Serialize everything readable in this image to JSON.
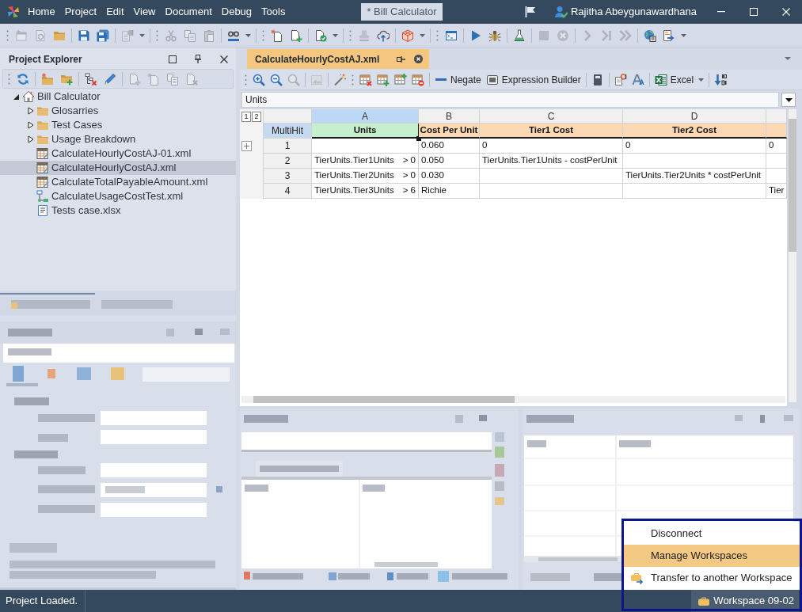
{
  "window": {
    "menu": [
      "Home",
      "Project",
      "Edit",
      "View",
      "Document",
      "Debug",
      "Tools"
    ],
    "document_title": "* Bill Calculator",
    "user": "Rajitha Abeygunawardhana"
  },
  "toolbar": [
    {
      "kind": "grip"
    },
    {
      "kind": "new-window",
      "disabled": true
    },
    {
      "kind": "reload",
      "disabled": true
    },
    {
      "kind": "open",
      "disabled": false
    },
    {
      "kind": "separator"
    },
    {
      "kind": "save",
      "disabled": false
    },
    {
      "kind": "save-all",
      "disabled": false
    },
    {
      "kind": "separator"
    },
    {
      "kind": "publish",
      "disabled": true,
      "dropdown": true
    },
    {
      "kind": "separator"
    },
    {
      "kind": "grip"
    },
    {
      "kind": "cut",
      "disabled": true
    },
    {
      "kind": "copy",
      "disabled": true
    },
    {
      "kind": "paste",
      "disabled": true
    },
    {
      "kind": "separator"
    },
    {
      "kind": "spellcheck",
      "disabled": false,
      "dropdown": true
    },
    {
      "kind": "separator"
    },
    {
      "kind": "grip"
    },
    {
      "kind": "new-file",
      "disabled": false
    },
    {
      "kind": "add-file",
      "disabled": false
    },
    {
      "kind": "separator"
    },
    {
      "kind": "validate",
      "disabled": false,
      "dropdown": true
    },
    {
      "kind": "separator"
    },
    {
      "kind": "grip"
    },
    {
      "kind": "stamp",
      "disabled": true
    },
    {
      "kind": "upload",
      "disabled": false
    },
    {
      "kind": "separator"
    },
    {
      "kind": "cube",
      "disabled": false,
      "dropdown": true
    },
    {
      "kind": "separator"
    },
    {
      "kind": "grip"
    },
    {
      "kind": "console",
      "disabled": false
    },
    {
      "kind": "separator"
    },
    {
      "kind": "run",
      "disabled": false
    },
    {
      "kind": "bug",
      "disabled": false
    },
    {
      "kind": "separator"
    },
    {
      "kind": "flask",
      "disabled": false
    },
    {
      "kind": "separator"
    },
    {
      "kind": "stop",
      "disabled": true
    },
    {
      "kind": "cancel",
      "disabled": true
    },
    {
      "kind": "separator"
    },
    {
      "kind": "step",
      "disabled": true
    },
    {
      "kind": "step-end",
      "disabled": true
    },
    {
      "kind": "fast-forward",
      "disabled": true
    },
    {
      "kind": "separator"
    },
    {
      "kind": "globe",
      "disabled": false
    },
    {
      "kind": "export",
      "disabled": false,
      "dropdown": true
    }
  ],
  "project_explorer": {
    "title": "Project Explorer",
    "toolbar": [
      {
        "kind": "grip"
      },
      {
        "kind": "refresh",
        "disabled": false
      },
      {
        "kind": "separator"
      },
      {
        "kind": "new-folder",
        "disabled": false
      },
      {
        "kind": "add-folder",
        "disabled": false
      },
      {
        "kind": "separator"
      },
      {
        "kind": "delete-tree",
        "disabled": false
      },
      {
        "kind": "pencil",
        "disabled": false
      },
      {
        "kind": "separator"
      },
      {
        "kind": "add-file",
        "disabled": true
      },
      {
        "kind": "new-file",
        "disabled": true
      },
      {
        "kind": "copy",
        "disabled": true
      },
      {
        "kind": "delete-file",
        "disabled": true
      }
    ],
    "tree": [
      {
        "label": "Bill Calculator",
        "kind": "project",
        "expanded": true,
        "selected": false,
        "children": [
          {
            "label": "Glosarries",
            "kind": "folder",
            "expanded": false,
            "selected": false
          },
          {
            "label": "Test Cases",
            "kind": "folder",
            "expanded": false,
            "selected": false
          },
          {
            "label": "Usage Breakdown",
            "kind": "folder",
            "expanded": false,
            "selected": false
          },
          {
            "label": "CalculateHourlyCostAJ-01.xml",
            "kind": "table",
            "selected": false
          },
          {
            "label": "CalculateHourlyCostAJ.xml",
            "kind": "table",
            "selected": true
          },
          {
            "label": "CalculateTotalPayableAmount.xml",
            "kind": "table",
            "selected": false
          },
          {
            "label": "CalculateUsageCostTest.xml",
            "kind": "flow",
            "selected": false
          },
          {
            "label": "Tests case.xlsx",
            "kind": "sheet",
            "selected": false
          }
        ]
      }
    ]
  },
  "editor": {
    "tabs": [
      {
        "label": "CalculateHourlyCostAJ.xml",
        "selected": true
      }
    ],
    "toolbar": [
      {
        "kind": "grip"
      },
      {
        "kind": "zoom-in",
        "disabled": false
      },
      {
        "kind": "zoom-out",
        "disabled": false
      },
      {
        "kind": "zoom",
        "disabled": true
      },
      {
        "kind": "separator"
      },
      {
        "kind": "image",
        "disabled": true
      },
      {
        "kind": "separator"
      },
      {
        "kind": "wand",
        "disabled": false
      },
      {
        "kind": "grip"
      },
      {
        "kind": "table-delete",
        "disabled": false
      },
      {
        "kind": "table-add",
        "disabled": false
      },
      {
        "kind": "table-add-col",
        "disabled": false
      },
      {
        "kind": "table-remove",
        "disabled": false
      },
      {
        "kind": "separator"
      },
      {
        "kind": "negate",
        "label": "Negate"
      },
      {
        "kind": "expression",
        "label": "Expression Builder"
      },
      {
        "kind": "separator"
      },
      {
        "kind": "book",
        "disabled": false
      },
      {
        "kind": "separator"
      },
      {
        "kind": "rules",
        "disabled": false
      },
      {
        "kind": "font",
        "disabled": false
      },
      {
        "kind": "separator"
      },
      {
        "kind": "excel",
        "label": "Excel",
        "dropdown": true
      },
      {
        "kind": "separator"
      },
      {
        "kind": "sort",
        "disabled": false
      }
    ],
    "formula": "Units",
    "grid": {
      "outline_levels": [
        "1",
        "2"
      ],
      "row_header_caption": "MultiHit",
      "columns": [
        {
          "letter": "A",
          "heading": "Units",
          "kind": "condition",
          "selected": true
        },
        {
          "letter": "B",
          "heading": "Cost Per Unit",
          "kind": "action",
          "selected": false
        },
        {
          "letter": "C",
          "heading": "Tier1 Cost",
          "kind": "action",
          "selected": false
        },
        {
          "letter": "D",
          "heading": "Tier2 Cost",
          "kind": "action",
          "selected": false
        },
        {
          "kind": "action",
          "selected": false
        }
      ],
      "rows": [
        {
          "number": "1",
          "expandable": true,
          "cells": [
            null,
            "0.060",
            "0",
            "0",
            "0"
          ]
        },
        {
          "number": "2",
          "expandable": false,
          "cells": [
            {
              "text": "TierUnits.Tier1Units",
              "condition": "> 0"
            },
            "0.050",
            "TierUnits.Tier1Units - costPerUnit",
            null,
            null
          ]
        },
        {
          "number": "3",
          "expandable": false,
          "cells": [
            {
              "text": "TierUnits.Tier2Units",
              "condition": "> 0"
            },
            "0.030",
            null,
            "TierUnits.Tier2Units * costPerUnit",
            null
          ]
        },
        {
          "number": "4",
          "expandable": false,
          "cells": [
            {
              "text": "TierUnits.Tier3Units",
              "condition": "> 6"
            },
            "Richie",
            null,
            null,
            "Tier"
          ]
        }
      ]
    }
  },
  "status_bar": {
    "message": "Project Loaded.",
    "workspace": "Workspace 09-02"
  },
  "workspace_menu": {
    "items": [
      {
        "label": "Disconnect",
        "kind": "plain",
        "selected": false
      },
      {
        "label": "Manage Workspaces",
        "kind": "plain",
        "selected": true
      },
      {
        "label": "Transfer to another Workspace",
        "kind": "transfer",
        "selected": false
      }
    ]
  }
}
